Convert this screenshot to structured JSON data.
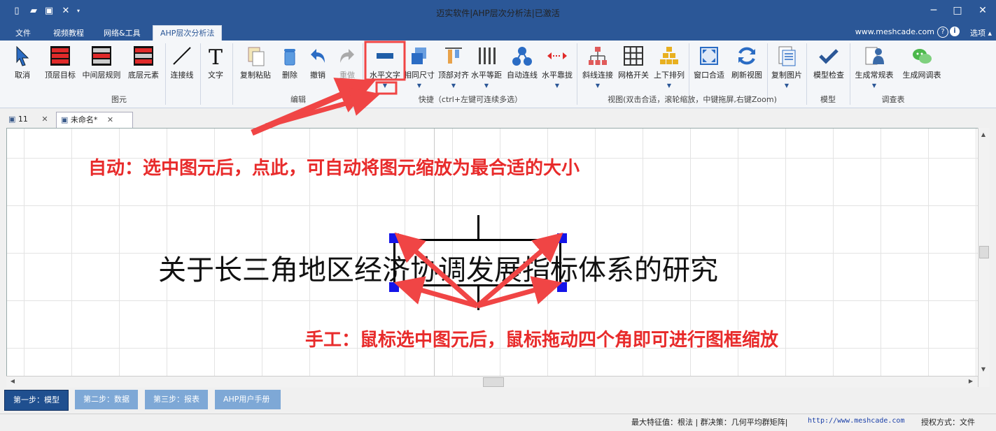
{
  "app": {
    "title": "迈实软件|AHP层次分析法|已激活",
    "website": "www.meshcade.com",
    "options_label": "选项"
  },
  "menu": [
    "文件",
    "视频教程",
    "网络&工具",
    "AHP层次分析法"
  ],
  "ribbon": {
    "buttons": [
      "取消",
      "顶层目标",
      "中间层规则",
      "底层元素",
      "连接线",
      "文字",
      "复制粘贴",
      "删除",
      "撤销",
      "重做",
      "水平文字",
      "相同尺寸",
      "顶部对齐",
      "水平等距",
      "自动连线",
      "水平靠拢",
      "斜线连接",
      "网格开关",
      "上下排列",
      "窗口合适",
      "刷新视图",
      "复制图片",
      "模型检查",
      "生成常规表",
      "生成网调表"
    ],
    "groups": [
      "图元",
      "编辑",
      "快捷（ctrl+左键可连续多选）",
      "视图(双击合适，滚轮缩放，中键拖屏,右键Zoom)",
      "模型",
      "调查表"
    ]
  },
  "doc_tabs": [
    "11",
    "未命名*"
  ],
  "canvas": {
    "main_text": "关于长三角地区经济协调发展指标体系的研究",
    "annotation_auto": "自动：选中图元后，点此，可自动将图元缩放为最合适的大小",
    "annotation_manual": "手工：鼠标选中图元后，鼠标拖动四个角即可进行图框缩放"
  },
  "steps": [
    "第一步：模型",
    "第二步：数据",
    "第三步：报表",
    "AHP用户手册"
  ],
  "status": {
    "eigen": "最大特征值：根法 | 群决策：几何平均群矩阵|",
    "url": "http://www.meshcade.com",
    "license": "授权方式：文件"
  },
  "colors": {
    "titlebar": "#2b5797",
    "annotation": "#e82b2b",
    "handle": "#1515e8"
  }
}
